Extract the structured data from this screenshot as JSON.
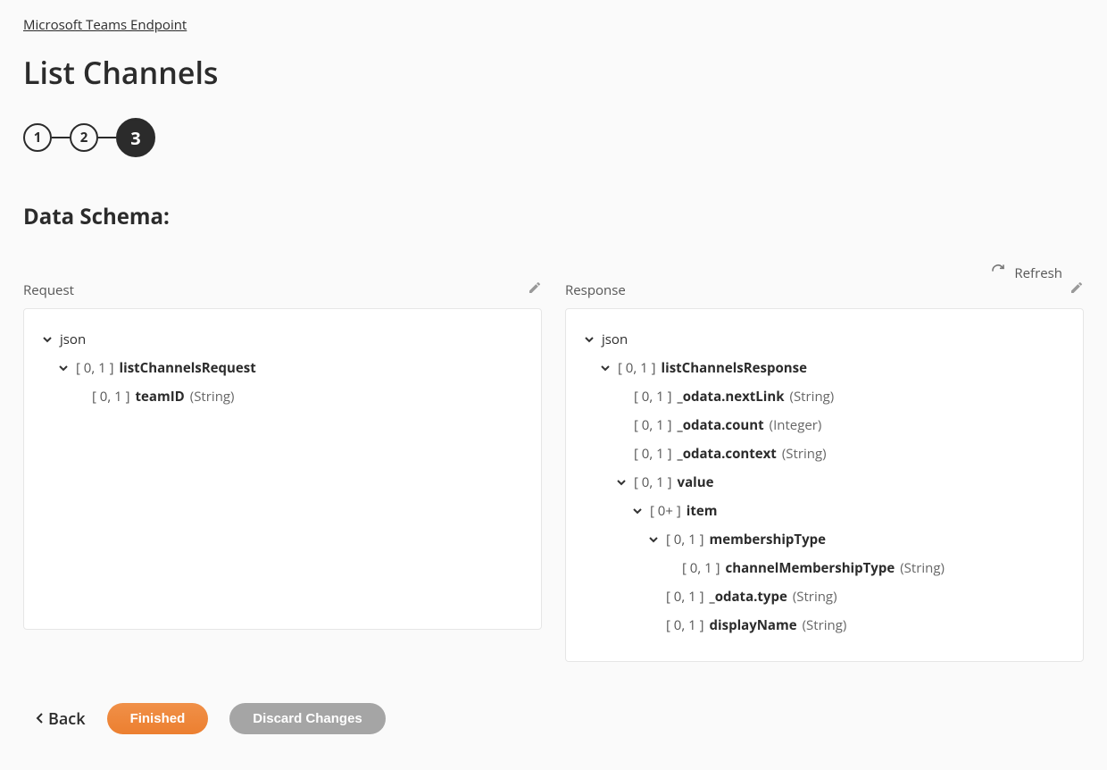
{
  "breadcrumb": "Microsoft Teams Endpoint",
  "title": "List Channels",
  "stepper": {
    "steps": [
      "1",
      "2",
      "3"
    ],
    "activeIndex": 2
  },
  "section": "Data Schema:",
  "refresh": "Refresh",
  "columns": {
    "request": {
      "title": "Request"
    },
    "response": {
      "title": "Response"
    }
  },
  "labels": {
    "json": "json",
    "card01": "[ 0, 1 ]",
    "card0plus": "[ 0+ ]"
  },
  "types": {
    "string": "(String)",
    "integer": "(Integer)"
  },
  "schema": {
    "request": {
      "listChannelsRequest": "listChannelsRequest",
      "teamID": "teamID"
    },
    "response": {
      "listChannelsResponse": "listChannelsResponse",
      "odata_nextLink": "_odata.nextLink",
      "odata_count": "_odata.count",
      "odata_context": "_odata.context",
      "value": "value",
      "item": "item",
      "membershipType": "membershipType",
      "channelMembershipType": "channelMembershipType",
      "odata_type": "_odata.type",
      "displayName": "displayName"
    }
  },
  "footer": {
    "back": "Back",
    "finished": "Finished",
    "discard": "Discard Changes"
  }
}
